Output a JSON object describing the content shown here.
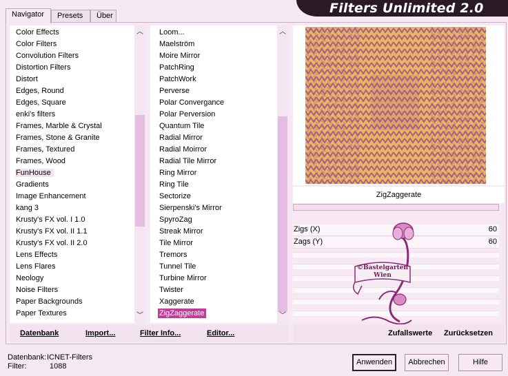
{
  "tabs": [
    {
      "label": "Navigator",
      "active": true
    },
    {
      "label": "Presets",
      "active": false
    },
    {
      "label": "Über",
      "active": false
    }
  ],
  "title": "Filters Unlimited 2.0",
  "categories": {
    "items": [
      "Color Effects",
      "Color Filters",
      "Convolution Filters",
      "Distortion Filters",
      "Distort",
      "Edges, Round",
      "Edges, Square",
      "enki's filters",
      "Frames, Marble & Crystal",
      "Frames, Stone & Granite",
      "Frames, Textured",
      "Frames, Wood",
      "FunHouse",
      "Gradients",
      "Image Enhancement",
      "kang 3",
      "Krusty's FX vol. I 1.0",
      "Krusty's FX vol. II 1.1",
      "Krusty's FX vol. II 2.0",
      "Lens Effects",
      "Lens Flares",
      "Neology",
      "Noise Filters",
      "Paper Backgrounds",
      "Paper Textures"
    ],
    "selected": "FunHouse"
  },
  "filters": {
    "items": [
      "Loom...",
      "Maelström",
      "Moire Mirror",
      "PatchRing",
      "PatchWork",
      "Perverse",
      "Polar Convergance",
      "Polar Perversion",
      "Quantum Tile",
      "Radial Mirror",
      "Radial Moirror",
      "Radial Tile Mirror",
      "Ring Mirror",
      "Ring Tile",
      "Sectorize",
      "Sierpenski's Mirror",
      "SpyroZag",
      "Streak Mirror",
      "Tile Mirror",
      "Tremors",
      "Tunnel Tile",
      "Turbine Mirror",
      "Twister",
      "Xaggerate",
      "ZigZaggerate"
    ],
    "selected": "ZigZaggerate"
  },
  "scroll_icons": {
    "up": "scroll-up-arrow-icon",
    "down": "scroll-down-arrow-icon",
    "up_glyph": "︿",
    "down_glyph": "﹀"
  },
  "filter_name": "ZigZaggerate",
  "parameters": [
    {
      "label": "Zigs (X)",
      "value": "60"
    },
    {
      "label": "Zags (Y)",
      "value": "60"
    }
  ],
  "toolbar": {
    "database": "Datenbank",
    "import": "Import...",
    "filter_info": "Filter Info...",
    "editor": "Editor...",
    "randomize": "Zufallswerte",
    "reset": "Zurücksetzen"
  },
  "status": {
    "database_label": "Datenbank:",
    "database_value": "ICNET-Filters",
    "filter_label": "Filter:",
    "filter_value": "1088"
  },
  "buttons": {
    "apply": "Anwenden",
    "cancel": "Abbrechen",
    "help": "Hilfe"
  },
  "watermark": {
    "text_line1": "©Bastelgarten",
    "text_line2": "Wien"
  },
  "colors": {
    "preview_bg": "#e9b660",
    "preview_stripe": "#a4528d",
    "selection": "#c13c9a",
    "scroll_thumb": "#e4bde0",
    "banner_bg": "#2a1a24"
  }
}
